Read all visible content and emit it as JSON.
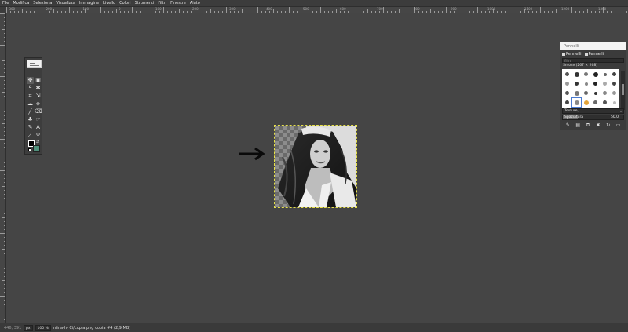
{
  "menubar": {
    "items": [
      "File",
      "Modifica",
      "Seleziona",
      "Visualizza",
      "Immagine",
      "Livello",
      "Colori",
      "Strumenti",
      "Filtri",
      "Finestre",
      "Aiuto"
    ]
  },
  "rulers": {
    "horizontal_labels": [
      "-300",
      "-200",
      "-100",
      "0",
      "100",
      "200",
      "300",
      "400",
      "500",
      "600",
      "700",
      "800",
      "900",
      "1000",
      "1100",
      "1200",
      "1300"
    ]
  },
  "toolbox": {
    "tools": [
      {
        "name": "move-tool",
        "glyph": "✥",
        "active": true
      },
      {
        "name": "rect-select-tool",
        "glyph": "▣"
      },
      {
        "name": "lasso-tool",
        "glyph": "ϟ"
      },
      {
        "name": "fuzzy-select-tool",
        "glyph": "✱"
      },
      {
        "name": "crop-tool",
        "glyph": "⌗"
      },
      {
        "name": "transform-tool",
        "glyph": "⇲"
      },
      {
        "name": "warp-tool",
        "glyph": "☁"
      },
      {
        "name": "bucket-fill-tool",
        "glyph": "◈"
      },
      {
        "name": "paintbrush-tool",
        "glyph": "╱"
      },
      {
        "name": "eraser-tool",
        "glyph": "⌫"
      },
      {
        "name": "clone-tool",
        "glyph": "♣"
      },
      {
        "name": "smudge-tool",
        "glyph": "☞"
      },
      {
        "name": "paths-tool",
        "glyph": "✎"
      },
      {
        "name": "text-tool",
        "glyph": "A"
      },
      {
        "name": "color-picker-tool",
        "glyph": "⟋"
      },
      {
        "name": "zoom-tool",
        "glyph": "⚲"
      }
    ],
    "foreground_color": "#000000",
    "background_color": "#4f8f7a"
  },
  "brushes_panel": {
    "title": "Pennelli",
    "tabs": [
      "Pennelli",
      "Pennelli"
    ],
    "filter_placeholder": "filtro",
    "brush_name": "Smoke (267 × 268)",
    "tag_select": "Texture,",
    "spacing_label": "Spaziatura",
    "spacing_value": "50.0",
    "spacing_fraction": 0.25,
    "buttons": [
      "edit-brush",
      "new-brush",
      "duplicate-brush",
      "delete-brush",
      "refresh-brushes",
      "open-as-image"
    ]
  },
  "statusbar": {
    "coords": "446, 391",
    "unit": "px",
    "zoom": "100 %",
    "message": "niina-h- Ci/copia.png copia #4 (2,9 MB)"
  }
}
